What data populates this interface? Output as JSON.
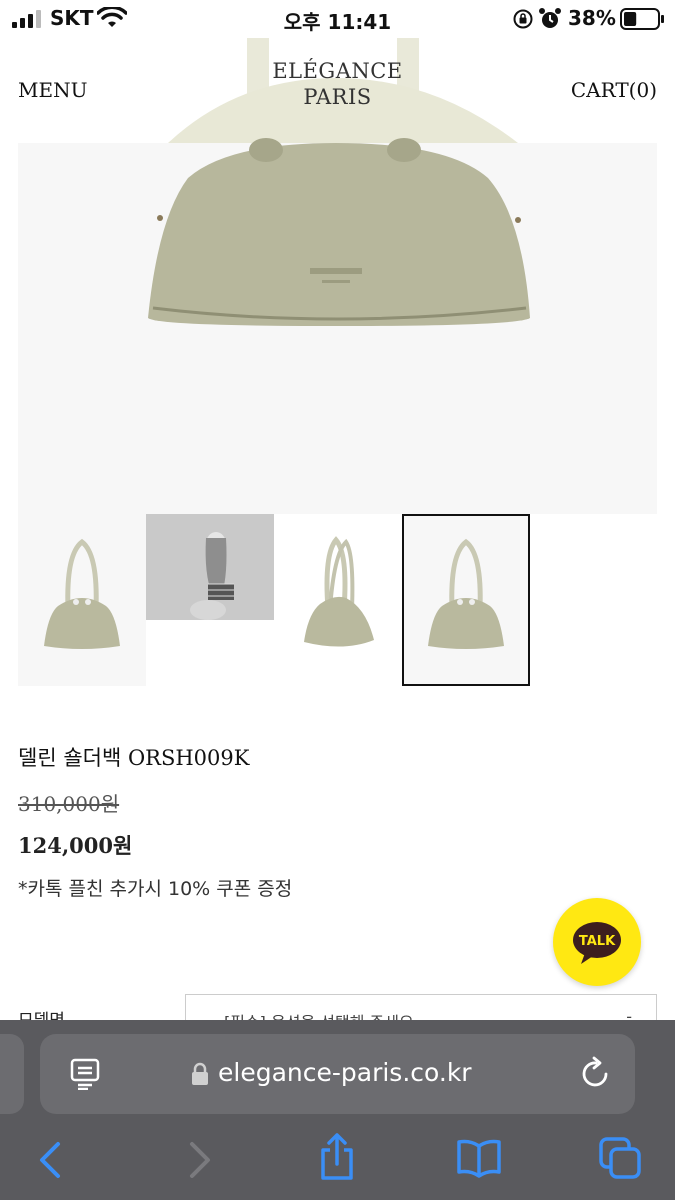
{
  "status_bar": {
    "carrier": "SKT",
    "time": "오후 11:41",
    "battery_percent": "38%",
    "battery_level": 0.38
  },
  "header": {
    "menu_label": "MENU",
    "brand_line1": "ELÉGANCE",
    "brand_line2": "PARIS",
    "cart_label": "CART(0)"
  },
  "thumbnails": [
    {
      "icon": "bag-thumbnail",
      "selected": false
    },
    {
      "icon": "model-photo-thumbnail",
      "selected": false
    },
    {
      "icon": "bag-side-thumbnail",
      "selected": false
    },
    {
      "icon": "bag-thumbnail",
      "selected": true
    }
  ],
  "product": {
    "name": "델린 숄더백 ORSH009K",
    "original_price": "310,000원",
    "sale_price": "124,000원",
    "coupon_note": "*카톡 플친 추가시 10% 쿠폰 증정"
  },
  "talk_button": {
    "label": "TALK"
  },
  "options": {
    "label": "모델명",
    "select_placeholder": "[필수] 옵션을 선택해 주세요",
    "select_arrow": "-"
  },
  "browser": {
    "url": "elegance-paris.co.kr"
  },
  "colors": {
    "bag": "#b7b79c",
    "kakao_yellow": "#ffe812",
    "browser_bar": "#5a5a5e",
    "ios_blue": "#3a8ef6"
  }
}
